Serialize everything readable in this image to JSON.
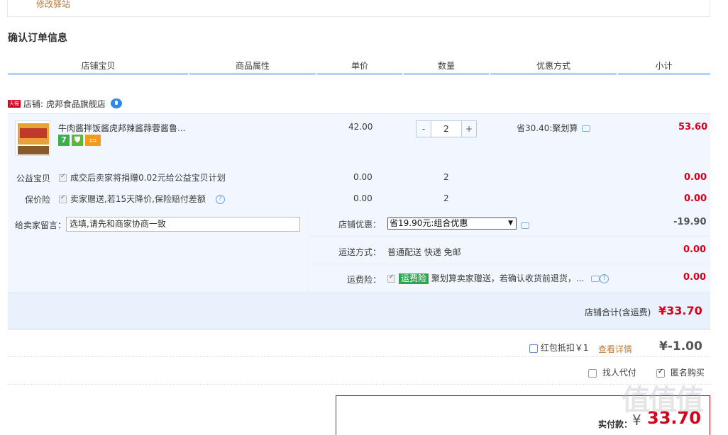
{
  "top": {
    "modify_station": "修改驿站"
  },
  "title": "确认订单信息",
  "columns": [
    "店铺宝贝",
    "商品属性",
    "单价",
    "数量",
    "优惠方式",
    "小计"
  ],
  "shop": {
    "badge": "天猫",
    "label": "店铺: 虎邦食品旗舰店"
  },
  "item": {
    "name": "牛肉酱拌饭酱虎邦辣酱蒜蓉酱鲁...",
    "badges": [
      "7",
      "",
      ""
    ],
    "price": "42.00",
    "qty_minus": "-",
    "quantity": "2",
    "qty_plus": "+",
    "discount": "省30.40:聚划算",
    "subtotal": "53.60"
  },
  "charity": {
    "label": "公益宝贝",
    "text": "成交后卖家将捐赠0.02元给公益宝贝计划",
    "price": "0.00",
    "qty": "2",
    "subtotal": "0.00"
  },
  "insurance": {
    "label": "保价险",
    "text": "卖家赠送,若15天降价,保险赔付差额",
    "help": "?",
    "price": "0.00",
    "qty": "2",
    "subtotal": "0.00"
  },
  "message": {
    "label": "给卖家留言：",
    "value": "选填,请先和商家协商一致"
  },
  "shop_discount": {
    "label": "店铺优惠：",
    "selected": "省19.90元:组合优惠",
    "amount": "-19.90"
  },
  "delivery": {
    "label": "运送方式：",
    "value": "普通配送 快递 免邮",
    "amount": "0.00"
  },
  "freight_insurance": {
    "label": "运费险：",
    "tag": "运费险",
    "text": "聚划算卖家赠送，若确认收货前退货，...",
    "help": "?",
    "amount": "0.00"
  },
  "shop_total": {
    "label": "店铺合计(含运费)",
    "amount": "¥33.70"
  },
  "redpacket": {
    "label": "红包抵扣￥1",
    "details": "查看详情",
    "amount": "¥-1.00"
  },
  "options": {
    "proxy_pay": "找人代付",
    "anonymous": "匿名购买"
  },
  "payment": {
    "label": "实付款：",
    "currency": "¥",
    "amount": "33.70"
  },
  "watermark": "值值值",
  "colors": {
    "accent_red": "#d5001c",
    "header_line": "#b2d1ff",
    "row_bg": "#f2f7ff"
  }
}
